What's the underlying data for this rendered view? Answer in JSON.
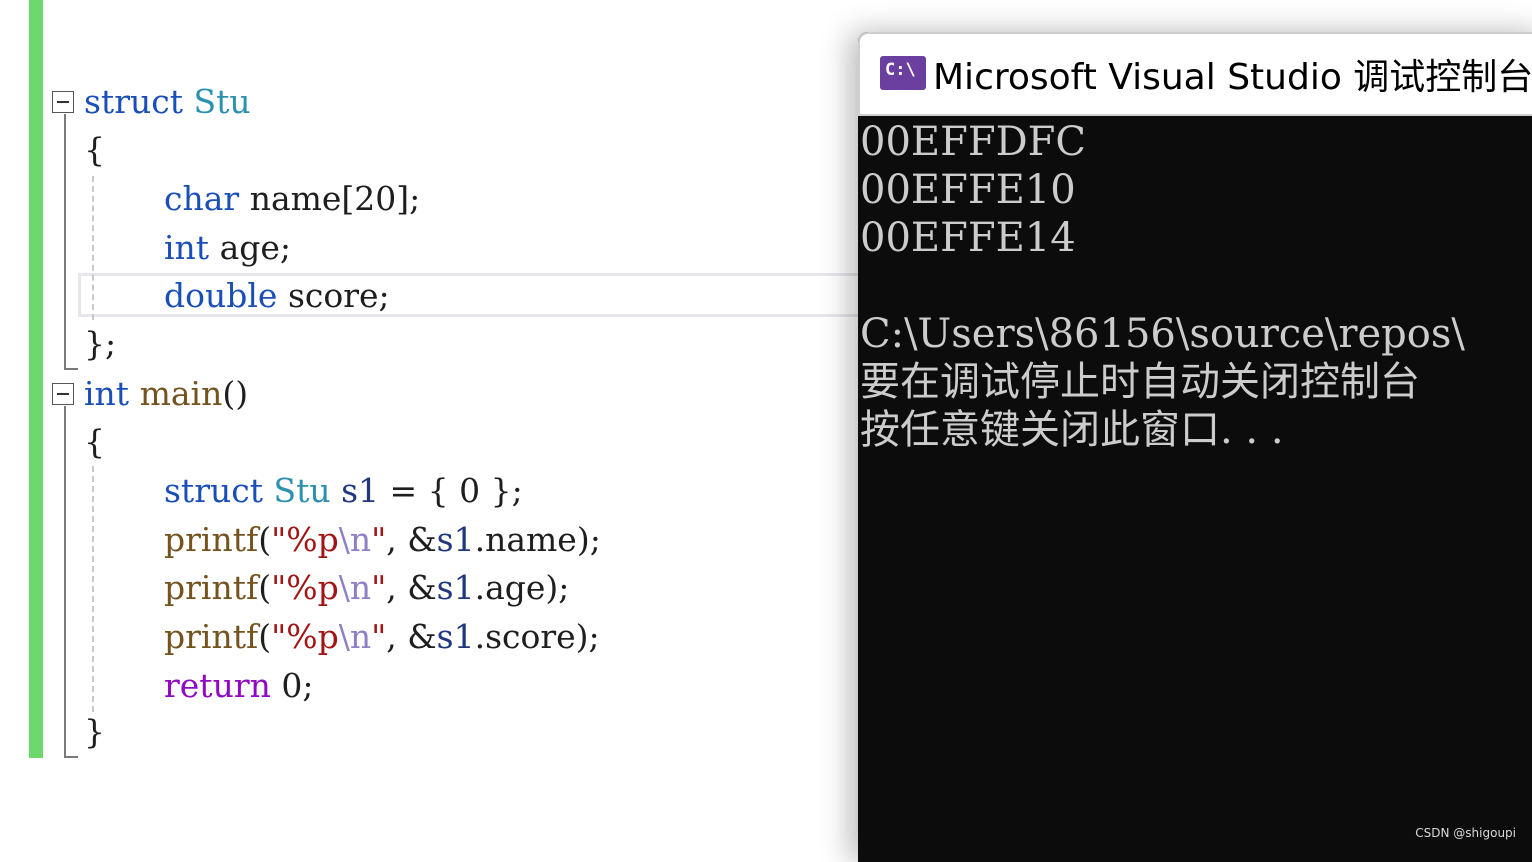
{
  "editor": {
    "lines": [
      {
        "kw": "struct",
        "ty": "Stu"
      },
      {
        "text": "{"
      },
      {
        "kw": "char",
        "rest": "name[20];"
      },
      {
        "kw": "int",
        "rest": "age;"
      },
      {
        "kw": "double",
        "rest": "score;"
      },
      {
        "text": "};"
      },
      {
        "kw": "int",
        "fn": "main",
        "rest": "()"
      },
      {
        "text": "{"
      },
      {
        "kw": "struct",
        "ty": "Stu",
        "id": "s1",
        "rest": "= { 0 };"
      },
      {
        "fn": "printf",
        "open": "(",
        "str_open": "\"%p",
        "esc": "\\n",
        "str_close": "\"",
        "amp": ", &",
        "id": "s1",
        "member": ".name);"
      },
      {
        "fn": "printf",
        "open": "(",
        "str_open": "\"%p",
        "esc": "\\n",
        "str_close": "\"",
        "amp": ", &",
        "id": "s1",
        "member": ".age);"
      },
      {
        "fn": "printf",
        "open": "(",
        "str_open": "\"%p",
        "esc": "\\n",
        "str_close": "\"",
        "amp": ", &",
        "id": "s1",
        "member": ".score);"
      },
      {
        "ctl": "return",
        "rest": "0;"
      },
      {
        "text": "}"
      }
    ]
  },
  "console": {
    "title": "Microsoft Visual Studio 调试控制台",
    "icon": "console-app-icon",
    "icon_text": "C:\\",
    "output": [
      "00EFFDFC",
      "00EFFE10",
      "00EFFE14",
      "",
      "C:\\Users\\86156\\source\\repos\\",
      "要在调试停止时自动关闭控制台",
      "按任意键关闭此窗口. . ."
    ]
  },
  "watermark": "CSDN @shigoupi",
  "colors": {
    "keyword": "#1a4fb8",
    "type": "#2b91af",
    "function": "#74531f",
    "string": "#a31515",
    "control": "#8f08c4",
    "change_bar": "#6bd96b",
    "console_bg": "#0c0c0c",
    "console_text": "#cccccc",
    "icon_bg": "#6b3fa0"
  }
}
